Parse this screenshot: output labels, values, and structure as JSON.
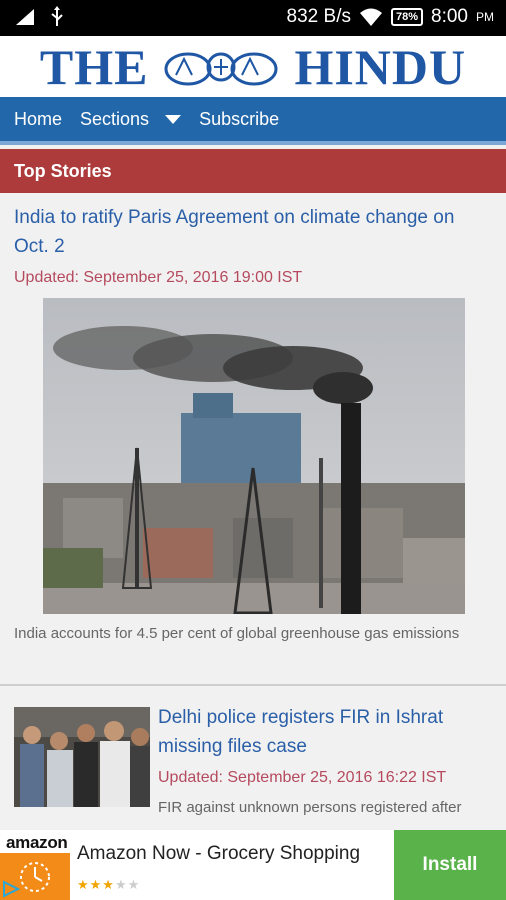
{
  "status_bar": {
    "network_speed": "832 B/s",
    "battery_percent": "78%",
    "time": "8:00",
    "ampm": "PM"
  },
  "masthead": {
    "left_word": "THE",
    "right_word": "HINDU"
  },
  "nav": {
    "home_label": "Home",
    "sections_label": "Sections",
    "subscribe_label": "Subscribe"
  },
  "section_header": "Top Stories",
  "stories": [
    {
      "headline": "India to ratify Paris Agreement on climate change on Oct. 2",
      "updated": "Updated: September 25, 2016 19:00 IST",
      "caption": "India accounts for 4.5 per cent of global greenhouse gas emissions"
    },
    {
      "headline": "Delhi police registers FIR in Ishrat missing files case",
      "updated": "Updated: September 25, 2016 16:22 IST",
      "summary": "FIR against unknown persons registered after"
    }
  ],
  "ad": {
    "brand": "amazon",
    "title": "Amazon Now - Grocery Shopping",
    "rating": 3,
    "rating_max": 5,
    "install_label": "Install"
  },
  "colors": {
    "nav_blue": "#2167aa",
    "section_red": "#ad3b3b",
    "headline_blue": "#2a5fa8",
    "updated_red": "#b54a5e",
    "install_green": "#5ab34a"
  }
}
